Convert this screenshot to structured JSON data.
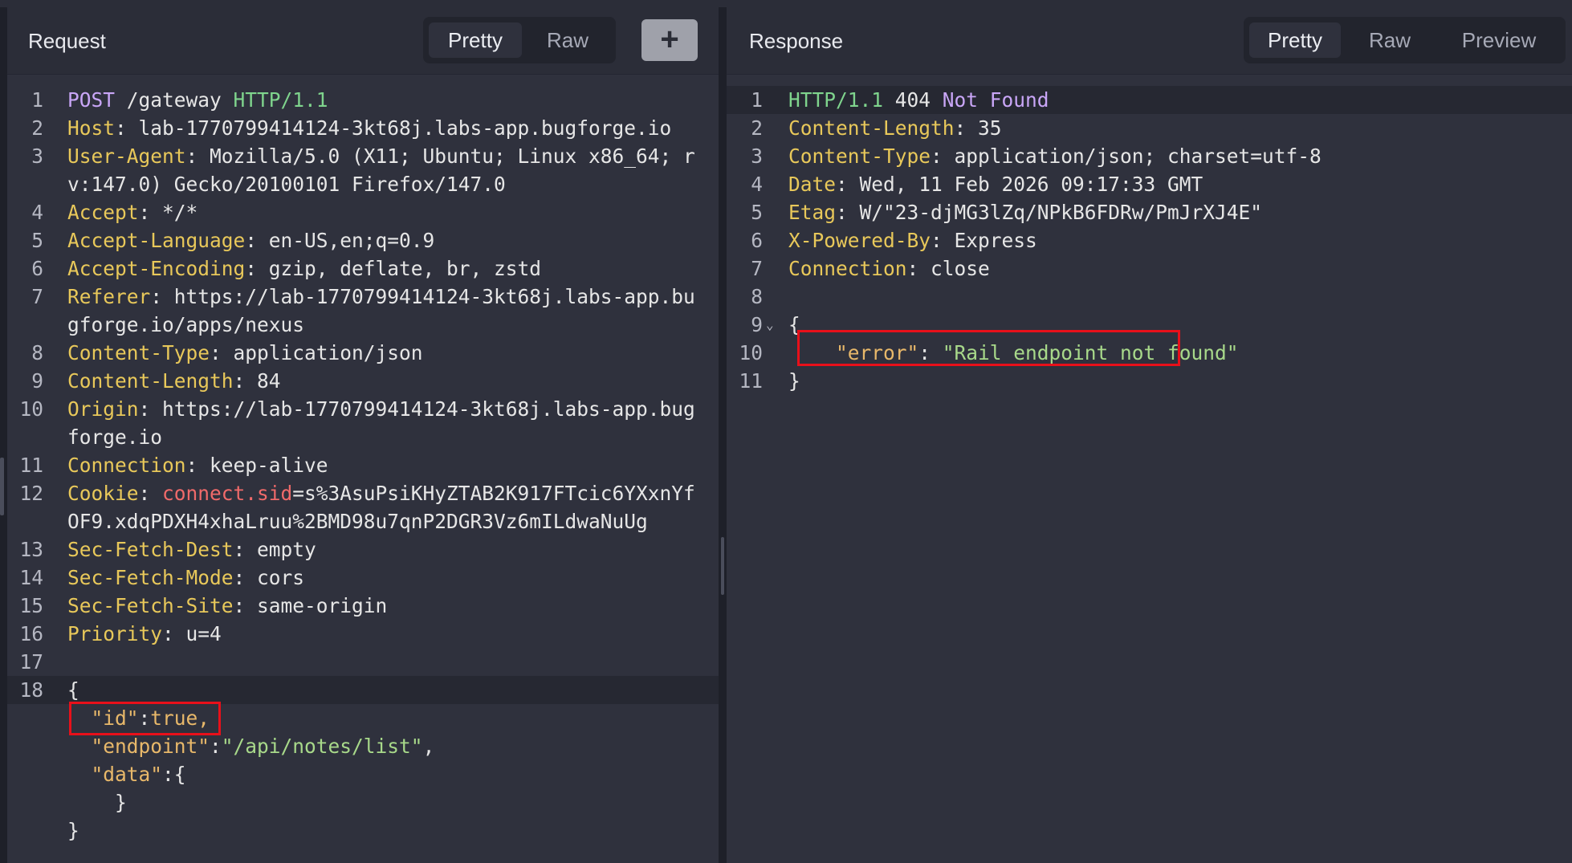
{
  "request": {
    "title": "Request",
    "tabs": [
      "Pretty",
      "Raw"
    ],
    "active_tab": "Pretty",
    "add_button_label": "+",
    "lines": {
      "l1": {
        "method": "POST",
        "path": " /gateway ",
        "version": "HTTP/1.1"
      },
      "l2": {
        "key": "Host",
        "value": ": lab-1770799414124-3kt68j.labs-app.bugforge.io"
      },
      "l3": {
        "key": "User-Agent",
        "value": ": Mozilla/5.0 (X11; Ubuntu; Linux x86_64; r",
        "wrap": "v:147.0) Gecko/20100101 Firefox/147.0"
      },
      "l4": {
        "key": "Accept",
        "value": ": */*"
      },
      "l5": {
        "key": "Accept-Language",
        "value": ": en-US,en;q=0.9"
      },
      "l6": {
        "key": "Accept-Encoding",
        "value": ": gzip, deflate, br, zstd"
      },
      "l7": {
        "key": "Referer",
        "value": ": https://lab-1770799414124-3kt68j.labs-app.bu",
        "wrap": "gforge.io/apps/nexus"
      },
      "l8": {
        "key": "Content-Type",
        "value": ": application/json"
      },
      "l9": {
        "key": "Content-Length",
        "value": ": 84"
      },
      "l10": {
        "key": "Origin",
        "value": ": https://lab-1770799414124-3kt68j.labs-app.bug",
        "wrap": "forge.io"
      },
      "l11": {
        "key": "Connection",
        "value": ": keep-alive"
      },
      "l12": {
        "key": "Cookie",
        "sep": ": ",
        "cookie_name": "connect.sid",
        "value": "=s%3AsuPsiKHyZTAB2K917FTcic6YXxnYf",
        "wrap": "OF9.xdqPDXH4xhaLruu%2BMD98u7qnP2DGR3Vz6mILdwaNuUg"
      },
      "l13": {
        "key": "Sec-Fetch-Dest",
        "value": ": empty"
      },
      "l14": {
        "key": "Sec-Fetch-Mode",
        "value": ": cors"
      },
      "l15": {
        "key": "Sec-Fetch-Site",
        "value": ": same-origin"
      },
      "l16": {
        "key": "Priority",
        "value": ": u=4"
      },
      "l18": {
        "brace": "{"
      }
    },
    "body": {
      "id_key": "\"id\"",
      "id_colon": ":",
      "id_value": "true,",
      "endpoint_key": "\"endpoint\"",
      "endpoint_colon": ":",
      "endpoint_value": "\"/api/notes/list\"",
      "endpoint_comma": ",",
      "data_key": "\"data\"",
      "data_open": ":{",
      "data_close": "}",
      "close": "}"
    }
  },
  "response": {
    "title": "Response",
    "tabs": [
      "Pretty",
      "Raw",
      "Preview"
    ],
    "active_tab": "Pretty",
    "lines": {
      "l1": {
        "version": "HTTP/1.1",
        "code": " 404 ",
        "status": "Not Found"
      },
      "l2": {
        "key": "Content-Length",
        "value": ": 35"
      },
      "l3": {
        "key": "Content-Type",
        "value": ": application/json; charset=utf-8"
      },
      "l4": {
        "key": "Date",
        "value": ": Wed, 11 Feb 2026 09:17:33 GMT"
      },
      "l5": {
        "key": "Etag",
        "value": ": W/\"23-djMG3lZq/NPkB6FDRw/PmJrXJ4E\""
      },
      "l6": {
        "key": "X-Powered-By",
        "value": ": Express"
      },
      "l7": {
        "key": "Connection",
        "value": ": close"
      },
      "l9": {
        "brace": "{"
      },
      "l10": {
        "key": "\"error\"",
        "colon": ": ",
        "value": "\"Rail endpoint not found\""
      },
      "l11": {
        "brace": "}"
      }
    }
  },
  "colors": {
    "header_key": "#e8c85a",
    "method": "#c9a6f7",
    "version": "#7fd48d",
    "cookie_name": "#f06a6a",
    "string": "#a8d98a",
    "highlight_box": "#e8101a"
  }
}
